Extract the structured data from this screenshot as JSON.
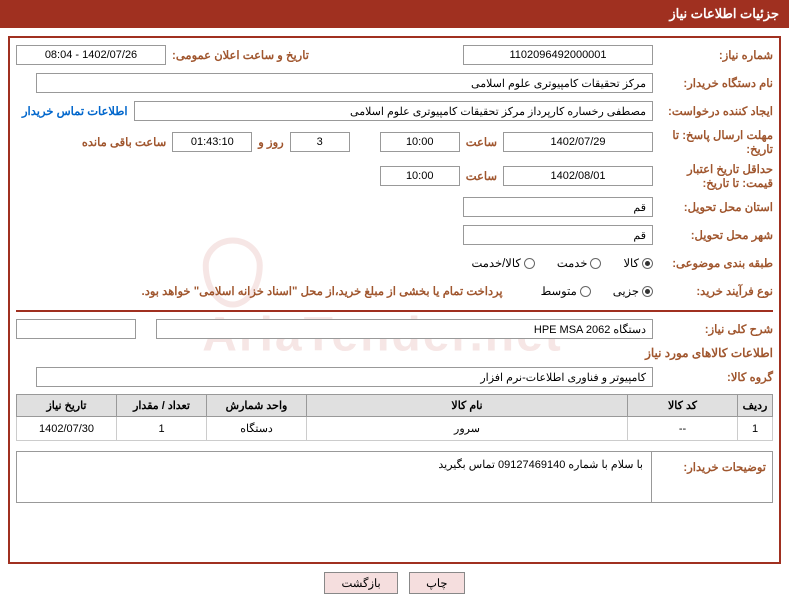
{
  "header": {
    "title": "جزئیات اطلاعات نیاز"
  },
  "fields": {
    "need_number_label": "شماره نیاز:",
    "need_number": "1102096492000001",
    "announce_datetime_label": "تاریخ و ساعت اعلان عمومی:",
    "announce_datetime": "1402/07/26 - 08:04",
    "buyer_org_label": "نام دستگاه خریدار:",
    "buyer_org": "مرکز تحقیقات کامپیوتری علوم اسلامی",
    "requester_label": "ایجاد کننده درخواست:",
    "requester": "مصطفی رخساره کارپرداز مرکز تحقیقات کامپیوتری علوم اسلامی",
    "buyer_contact_link": "اطلاعات تماس خریدار",
    "response_deadline_label": "مهلت ارسال پاسخ: تا تاریخ:",
    "response_deadline_date": "1402/07/29",
    "time_label": "ساعت",
    "response_deadline_time": "10:00",
    "remaining_days": "3",
    "days_and_label": "روز و",
    "remaining_time": "01:43:10",
    "remaining_suffix": "ساعت باقی مانده",
    "validity_label": "حداقل تاریخ اعتبار قیمت: تا تاریخ:",
    "validity_date": "1402/08/01",
    "validity_time": "10:00",
    "delivery_province_label": "استان محل تحویل:",
    "delivery_province": "قم",
    "delivery_city_label": "شهر محل تحویل:",
    "delivery_city": "قم",
    "category_label": "طبقه بندی موضوعی:",
    "purchase_type_label": "نوع فرآیند خرید:",
    "payment_note": "پرداخت تمام یا بخشی از مبلغ خرید،از محل \"اسناد خزانه اسلامی\" خواهد بود.",
    "summary_label": "شرح کلی نیاز:",
    "summary": "دستگاه HPE MSA 2062",
    "goods_info_title": "اطلاعات کالاهای مورد نیاز",
    "goods_group_label": "گروه کالا:",
    "goods_group": "کامپیوتر و فناوری اطلاعات-نرم افزار",
    "buyer_notes_label": "توضیحات خریدار:",
    "buyer_notes": "با سلام با شماره 09127469140 تماس بگیرید"
  },
  "category_options": [
    {
      "label": "کالا",
      "checked": true
    },
    {
      "label": "خدمت",
      "checked": false
    },
    {
      "label": "کالا/خدمت",
      "checked": false
    }
  ],
  "purchase_type_options": [
    {
      "label": "جزیی",
      "checked": true
    },
    {
      "label": "متوسط",
      "checked": false
    }
  ],
  "table": {
    "headers": {
      "row": "ردیف",
      "code": "کد کالا",
      "name": "نام کالا",
      "unit": "واحد شمارش",
      "qty": "تعداد / مقدار",
      "date": "تاریخ نیاز"
    },
    "rows": [
      {
        "row": "1",
        "code": "--",
        "name": "سرور",
        "unit": "دستگاه",
        "qty": "1",
        "date": "1402/07/30"
      }
    ]
  },
  "buttons": {
    "print": "چاپ",
    "back": "بازگشت"
  },
  "watermark": "AriaTender.net"
}
